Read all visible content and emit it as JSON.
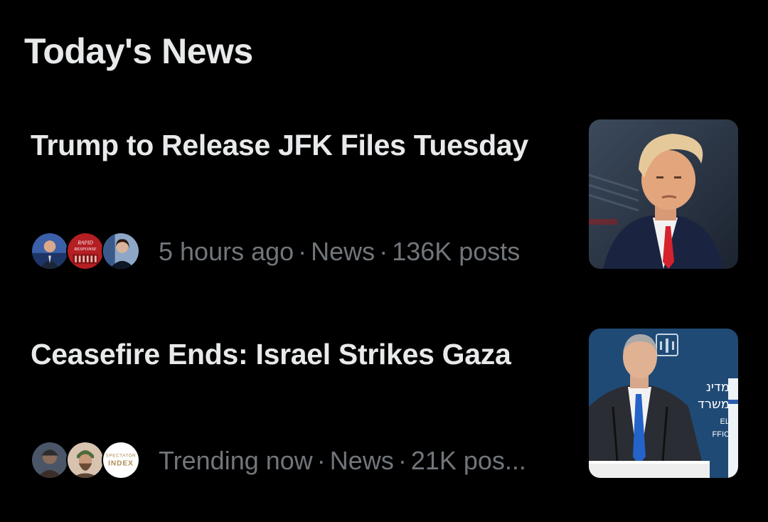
{
  "section": {
    "title": "Today's News"
  },
  "items": [
    {
      "headline": "Trump to Release JFK Files Tuesday",
      "time": "5 hours ago",
      "category": "News",
      "posts": "136K posts",
      "avatar_2_text": "RAPID RESPONSE"
    },
    {
      "headline": "Ceasefire Ends: Israel Strikes Gaza",
      "time": "Trending now",
      "category": "News",
      "posts": "21K pos...",
      "avatar_3_text": "SPECTATOR INDEX",
      "thumb_text": "מדינת ישראל משרד ... ISRAEL OFFICE"
    }
  ],
  "colors": {
    "background": "#000000",
    "primary_text": "#e7e9ea",
    "secondary_text": "#71767b"
  },
  "icons": {
    "separator": "middle-dot"
  }
}
